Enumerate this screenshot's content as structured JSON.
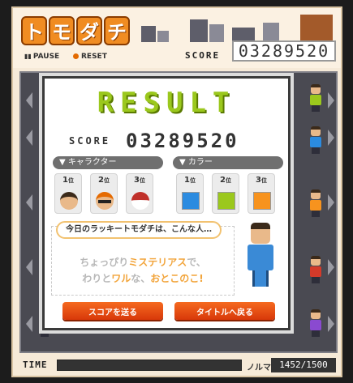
{
  "header": {
    "logo": [
      "ト",
      "モ",
      "ダ",
      "チ"
    ],
    "pause_label": "PAUSE",
    "reset_label": "RESET",
    "score_label": "SCORE",
    "score_value": "03289520"
  },
  "result": {
    "title": "RESULT",
    "score_label": "SCORE",
    "score_value": "03289520",
    "character_section": "▼ キャラクター",
    "color_section": "▼ カラー",
    "character_ranks": [
      {
        "rank": "1",
        "suffix": "位",
        "icon": "boy-face-icon"
      },
      {
        "rank": "2",
        "suffix": "位",
        "icon": "sunglasses-face-icon"
      },
      {
        "rank": "3",
        "suffix": "位",
        "icon": "mushroom-face-icon"
      }
    ],
    "color_ranks": [
      {
        "rank": "1",
        "suffix": "位",
        "color": "#2b8be0"
      },
      {
        "rank": "2",
        "suffix": "位",
        "color": "#9bc81d"
      },
      {
        "rank": "3",
        "suffix": "位",
        "color": "#f7931e"
      }
    ],
    "lucky_heading": "今日のラッキートモダチは、こんな人…",
    "lucky_line1_pre": "ちょっぴり",
    "lucky_line1_hl": "ミステリアス",
    "lucky_line1_post": "で、",
    "lucky_line2_pre": "わりと",
    "lucky_line2_hl1": "ワル",
    "lucky_line2_mid": "な、",
    "lucky_line2_hl2": "おとこのこ!",
    "send_score_button": "スコアを送る",
    "back_title_button": "タイトルへ戻る"
  },
  "footer": {
    "time_label": "TIME",
    "time_remaining": 0,
    "norma_label": "ノルマ",
    "norma_value": "1452/1500"
  },
  "colors": {
    "accent": "#9bc81d",
    "button": "#e84c14",
    "logo": "#f08c22"
  }
}
